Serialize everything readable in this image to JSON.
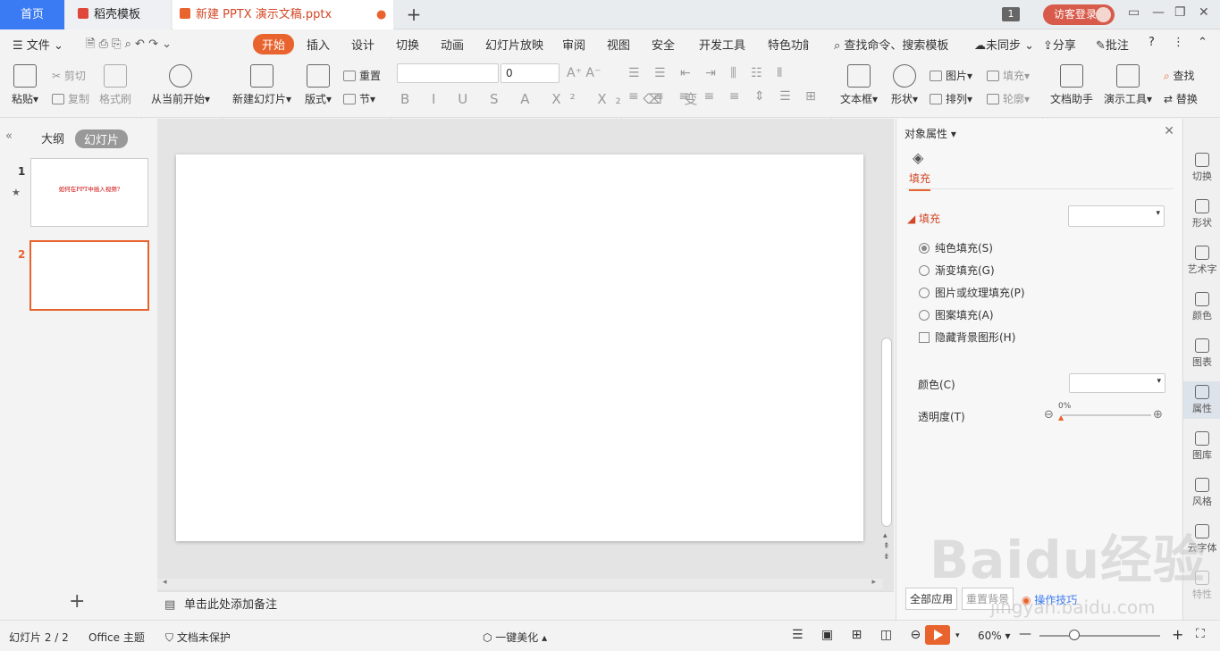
{
  "tabs": {
    "home": "首页",
    "template": "稻壳模板",
    "doc": "新建 PPTX 演示文稿.pptx"
  },
  "window": {
    "badge": "1",
    "login": "访客登录"
  },
  "menu": {
    "file": "文件",
    "items": [
      "开始",
      "插入",
      "设计",
      "切换",
      "动画",
      "幻灯片放映",
      "审阅",
      "视图",
      "安全",
      "开发工具",
      "特色功能"
    ],
    "search": "查找命令、搜索模板",
    "sync": "未同步",
    "share": "分享",
    "comment": "批注"
  },
  "ribbon": {
    "paste": "粘贴",
    "cut": "剪切",
    "copy": "复制",
    "format_painter": "格式刷",
    "play_from_current": "从当前开始",
    "new_slide": "新建幻灯片",
    "layout": "版式",
    "reset": "重置",
    "section": "节",
    "font_size": "0",
    "textbox": "文本框",
    "shape": "形状",
    "picture": "图片",
    "arrange": "排列",
    "fill": "填充",
    "outline": "轮廓",
    "doc_assistant": "文档助手",
    "present_tools": "演示工具",
    "find": "查找",
    "replace": "替换"
  },
  "left_pane": {
    "tab_outline": "大纲",
    "tab_slides": "幻灯片",
    "slides": [
      {
        "num": "1",
        "title": "如何在PPT中插入视频?"
      },
      {
        "num": "2",
        "title": ""
      }
    ]
  },
  "notes_placeholder": "单击此处添加备注",
  "right_pane": {
    "title": "对象属性",
    "tab_fill": "填充",
    "section_fill": "填充",
    "options": [
      "纯色填充(S)",
      "渐变填充(G)",
      "图片或纹理填充(P)",
      "图案填充(A)"
    ],
    "hide_bg": "隐藏背景图形(H)",
    "color_label": "颜色(C)",
    "transparency_label": "透明度(T)",
    "transparency_value": "0%",
    "apply_all": "全部应用",
    "reset_bg": "重置背景",
    "tips": "操作技巧"
  },
  "sidebar": [
    "切换",
    "形状",
    "艺术字",
    "颜色",
    "图表",
    "属性",
    "图库",
    "风格",
    "云字体",
    "特性"
  ],
  "status": {
    "slide_pos": "幻灯片 2 / 2",
    "theme": "Office 主题",
    "protect": "文档未保护",
    "beautify": "一键美化",
    "zoom": "60%"
  },
  "watermark": {
    "main": "Baidu经验",
    "sub": "jingyan.baidu.com"
  },
  "colors": {
    "accent": "#e8632d",
    "home_tab": "#3a7af2",
    "login": "#d75a4a"
  }
}
